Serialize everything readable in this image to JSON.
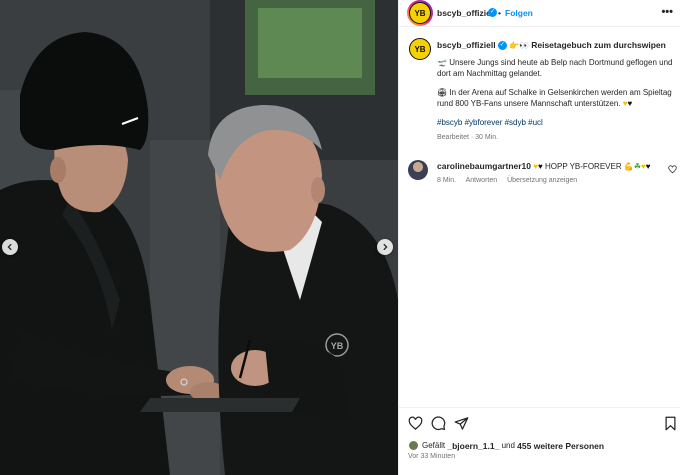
{
  "header": {
    "username": "bscyb_offiziell",
    "follow_label": "Folgen",
    "separator": "•",
    "more": "•••"
  },
  "caption": {
    "username": "bscyb_offiziell",
    "title": "Reisetagebuch zum durchswipen",
    "paragraph1": "Unsere Jungs sind heute ab Belp nach Dortmund geflogen und dort am Nachmittag gelandet.",
    "paragraph2": "In der Arena auf Schalke in Gelsenkirchen werden am Spieltag rund 800 YB-Fans unsere Mannschaft unterstützen.",
    "hashtags": "#bscyb #ybforever #sdyb #ucl",
    "edited_meta": "Bearbeitet · 30 Min."
  },
  "comment": {
    "username": "carolinebaumgartner10",
    "text": "HOPP YB-FOREVER",
    "time": "8 Min.",
    "reply": "Antworten",
    "translate": "Übersetzung anzeigen"
  },
  "likes": {
    "prefix": "Gefällt",
    "user": "_bjoern_1.1_",
    "middle": "und",
    "others": "455 weitere Personen"
  },
  "timestamp": "Vor 33 Minuten",
  "avatar_text": "YB",
  "icons": [
    "heart-icon",
    "comment-icon",
    "share-icon",
    "bookmark-icon",
    "chevron-left-icon",
    "chevron-right-icon"
  ],
  "colors": {
    "accent": "#0095f6",
    "yb_yellow": "#f6d000"
  }
}
